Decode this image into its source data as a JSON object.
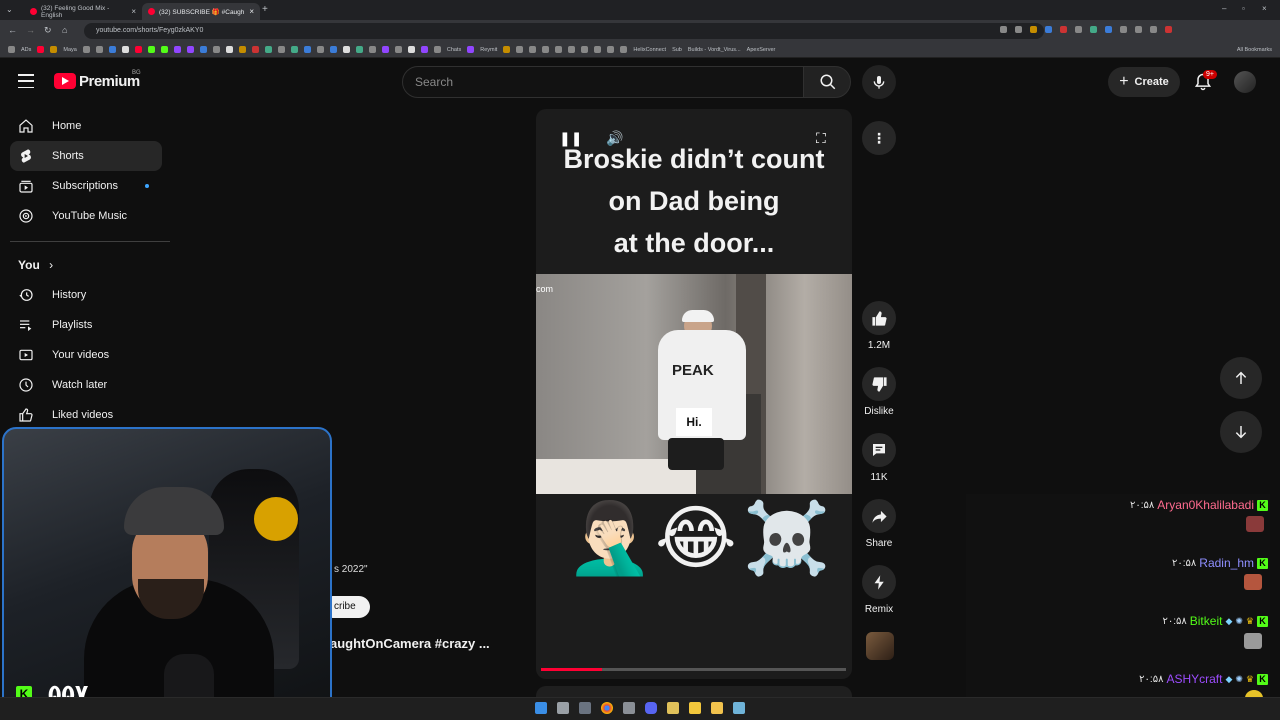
{
  "browser": {
    "tabs": [
      {
        "label": "(32) Feeling Good Mix - English"
      },
      {
        "label": "(32) SUBSCRIBE 🎁 #Caugh"
      }
    ],
    "url": "youtube.com/shorts/Feyg0zkAKY0",
    "bookmarks": [
      "ADs",
      "Maya",
      "Chats",
      "Reymit",
      "HelixConnect",
      "Sub",
      "Builds - Vordt_Virus...",
      "ApexServer",
      "All Bookmarks"
    ]
  },
  "header": {
    "logo": "Premium",
    "country": "BG",
    "search_placeholder": "Search",
    "create_label": "Create",
    "notif_count": "9+"
  },
  "sidebar": {
    "main": [
      {
        "label": "Home",
        "icon": "home-icon"
      },
      {
        "label": "Shorts",
        "icon": "shorts-icon"
      },
      {
        "label": "Subscriptions",
        "icon": "subscriptions-icon"
      },
      {
        "label": "YouTube Music",
        "icon": "music-icon"
      }
    ],
    "you_label": "You",
    "you_items": [
      {
        "label": "History",
        "icon": "history-icon"
      },
      {
        "label": "Playlists",
        "icon": "playlists-icon"
      },
      {
        "label": "Your videos",
        "icon": "your-videos-icon"
      },
      {
        "label": "Watch later",
        "icon": "watch-later-icon"
      },
      {
        "label": "Liked videos",
        "icon": "liked-icon"
      }
    ]
  },
  "background": {
    "partial_title": "s 2022\"",
    "subscribe_partial": "cribe",
    "tags_partial": "aughtOnCamera #crazy ..."
  },
  "webcam": {
    "badge": "K",
    "count": "۵۵۷"
  },
  "short": {
    "caption_lines": [
      "Broskie didn’t count",
      "on Dad being",
      "at the door..."
    ],
    "frame_label": "com",
    "shirt_text": "PEAK",
    "sign_text": "Hi.",
    "emojis": [
      "🤦🏻‍♂️",
      "😂",
      "☠️"
    ],
    "progress": 0.2
  },
  "actions": {
    "like_count": "1.2M",
    "dislike_label": "Dislike",
    "comments_count": "11K",
    "share_label": "Share",
    "remix_label": "Remix"
  },
  "chat": [
    {
      "time": "۲۰:۵۸",
      "user": "Aryan0Khalilabadi",
      "color": "#ff6b8f"
    },
    {
      "time": "۲۰:۵۸",
      "user": "Radin_hm",
      "color": "#8f8fff"
    },
    {
      "time": "۲۰:۵۸",
      "user": "Bitkeit",
      "color": "#53fc18"
    },
    {
      "time": "۲۰:۵۸",
      "user": "ASHYcraft",
      "color": "#9d4dff"
    }
  ],
  "colors": {
    "accent": "#ff0033",
    "kick_green": "#53fc18",
    "link_blue": "#3ea6ff"
  }
}
